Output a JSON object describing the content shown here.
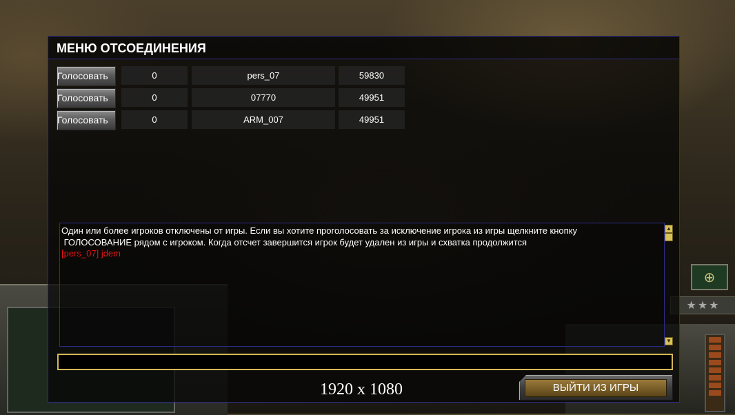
{
  "modal": {
    "title": "МЕНЮ ОТСОЕДИНЕНИЯ",
    "vote_label": "Голосовать",
    "players": [
      {
        "votes": "0",
        "name": "pers_07",
        "ping": "59830"
      },
      {
        "votes": "0",
        "name": "07770",
        "ping": "49951"
      },
      {
        "votes": "0",
        "name": "ARM_007",
        "ping": "49951"
      }
    ],
    "chat": [
      "Один или более игроков отключены от игры. Если вы хотите проголосовать за исключение игрока из игры щелкните кнопку",
      " ГОЛОСОВАНИЕ рядом с игроком. Когда отсчет завершится игрок будет удален из игры и схватка продолжится",
      "[pers_07] jdem"
    ],
    "chat_input_value": "",
    "exit_label": "ВЫЙТИ ИЗ ИГРЫ"
  },
  "overlay_resolution": "1920 x 1080",
  "colors": {
    "accent_gold": "#d6b858",
    "panel_border": "#2c2c88",
    "chat_highlight": "#e01414"
  }
}
